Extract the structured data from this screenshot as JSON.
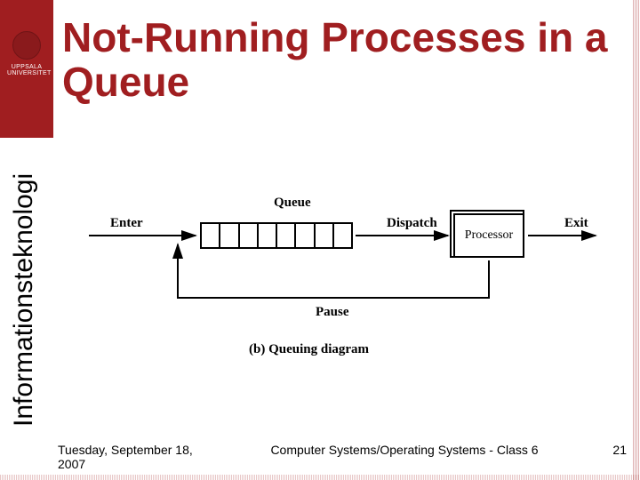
{
  "header": {
    "title": "Not-Running Processes in a Queue",
    "university": "UPPSALA UNIVERSITET"
  },
  "sidebar": {
    "department": "Informationsteknologi"
  },
  "diagram": {
    "labels": {
      "enter": "Enter",
      "queue": "Queue",
      "dispatch": "Dispatch",
      "processor": "Processor",
      "exit": "Exit",
      "pause": "Pause"
    },
    "queue_slots": 8,
    "caption": "(b) Queuing diagram"
  },
  "footer": {
    "date": "Tuesday, September 18, 2007",
    "course": "Computer Systems/Operating Systems - Class 6",
    "page": "21"
  }
}
